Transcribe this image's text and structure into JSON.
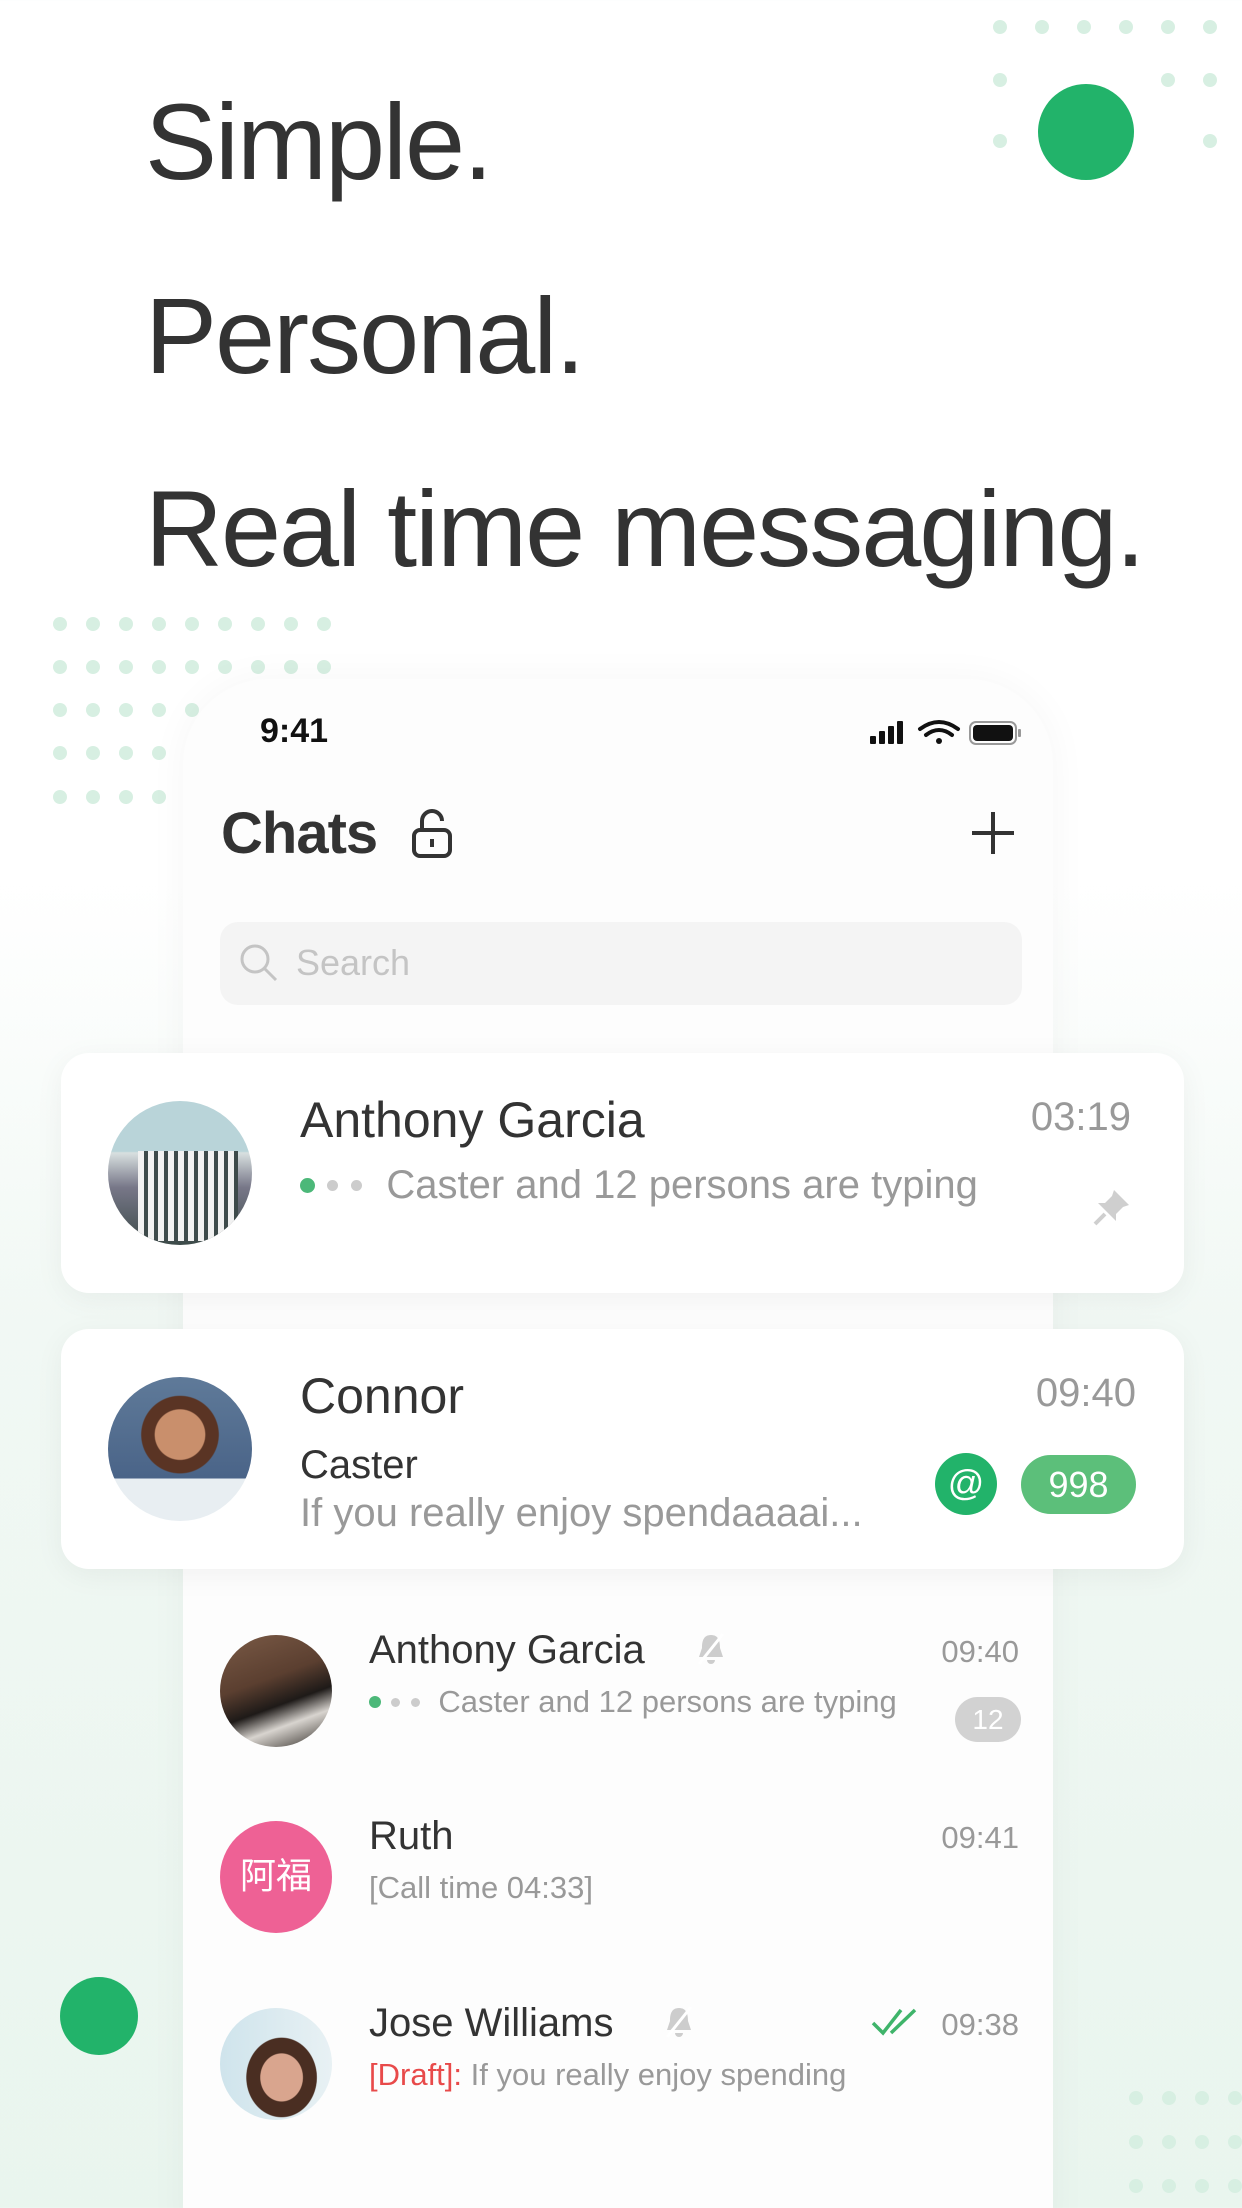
{
  "headlines": [
    "Simple.",
    "Personal.",
    "Real time messaging."
  ],
  "colors": {
    "accent": "#22b36a",
    "badge_green": "#5cbf7a",
    "pink": "#ee6195",
    "draft_red": "#e84a4a"
  },
  "status_bar": {
    "time": "9:41"
  },
  "header": {
    "title": "Chats",
    "lock_icon": "unlock-icon",
    "add_icon": "plus-icon"
  },
  "search": {
    "placeholder": "Search"
  },
  "featured_chats": [
    {
      "name": "Anthony Garcia",
      "time": "03:19",
      "message": "Caster and 12 persons are typing",
      "pinned": true
    },
    {
      "name": "Connor",
      "time": "09:40",
      "sender": "Caster",
      "message": "If you really enjoy spendaaaai...",
      "mention": "@",
      "unread": "998"
    }
  ],
  "chats": [
    {
      "name": "Anthony Garcia",
      "time": "09:40",
      "message": "Caster and 12 persons are typing",
      "muted": true,
      "unread": "12"
    },
    {
      "name": "Ruth",
      "time": "09:41",
      "message": "[Call time 04:33]",
      "avatar_text": "阿福"
    },
    {
      "name": "Jose Williams",
      "time": "09:38",
      "draft_label": "[Draft]:",
      "message": "If you really enjoy spending",
      "muted": true,
      "read": true
    }
  ]
}
